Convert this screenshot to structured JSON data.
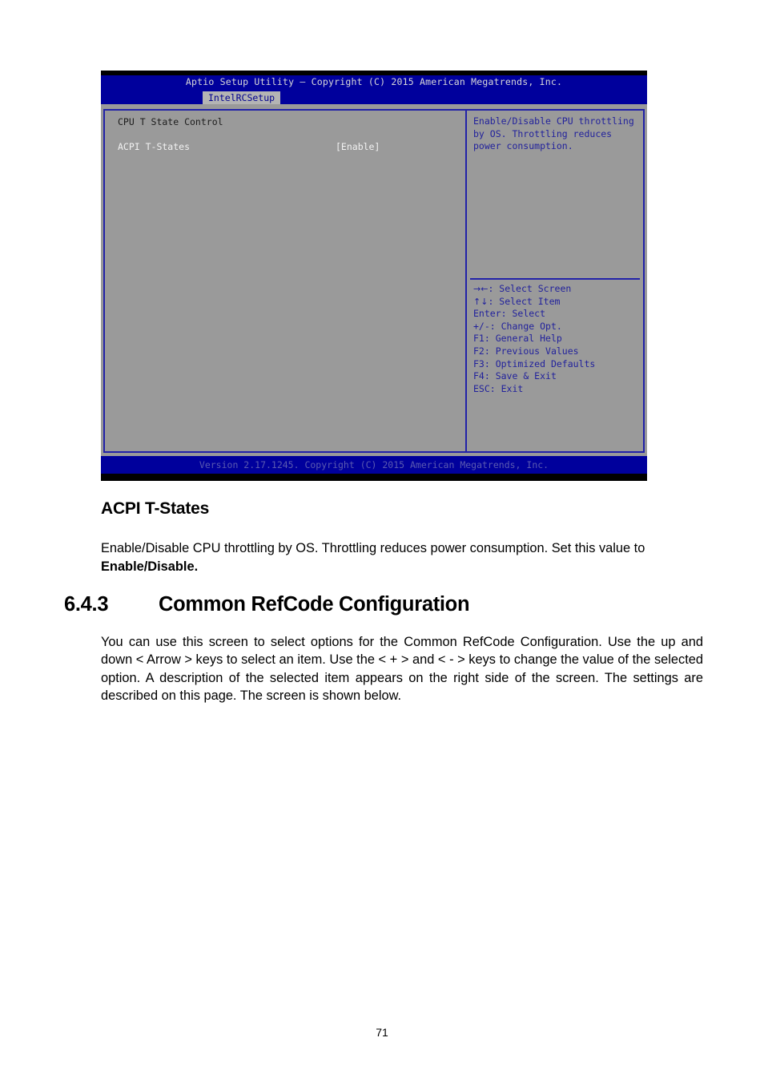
{
  "bios": {
    "title": "Aptio Setup Utility – Copyright (C) 2015 American Megatrends, Inc.",
    "tab": "IntelRCSetup",
    "left_panel": {
      "heading": "CPU T State Control",
      "options": [
        {
          "label": "ACPI T-States",
          "value": "[Enable]"
        }
      ]
    },
    "right_panel": {
      "help_text": "Enable/Disable CPU throttling by OS. Throttling reduces power consumption.",
      "legend": [
        {
          "keys": "→←",
          "action": ": Select Screen"
        },
        {
          "keys": "↑↓",
          "action": ": Select Item"
        },
        {
          "keys": "Enter",
          "action": ": Select"
        },
        {
          "keys": "+/-",
          "action": ": Change Opt."
        },
        {
          "keys": "F1",
          "action": ": General Help"
        },
        {
          "keys": "F2",
          "action": ": Previous Values"
        },
        {
          "keys": "F3",
          "action": ": Optimized Defaults"
        },
        {
          "keys": "F4",
          "action": ": Save & Exit"
        },
        {
          "keys": "ESC",
          "action": ": Exit"
        }
      ]
    },
    "footer": "Version 2.17.1245. Copyright (C) 2015 American Megatrends, Inc."
  },
  "document": {
    "subheading": "ACPI T-States",
    "paragraph1_lead": "Enable/Disable CPU throttling by OS. Throttling reduces power consumption. Set this value to ",
    "paragraph1_bold": "Enable/Disable.",
    "section_number": "6.4.3",
    "section_title": "Common RefCode Configuration",
    "paragraph2": "You can use this screen to select options for the Common RefCode Configuration. Use the up and down < Arrow > keys to select an item. Use the < + > and < - > keys to change the value of the selected option. A description of the selected item appears on the right side of the screen. The settings are described on this page. The screen is shown below.",
    "page_number": "71"
  }
}
